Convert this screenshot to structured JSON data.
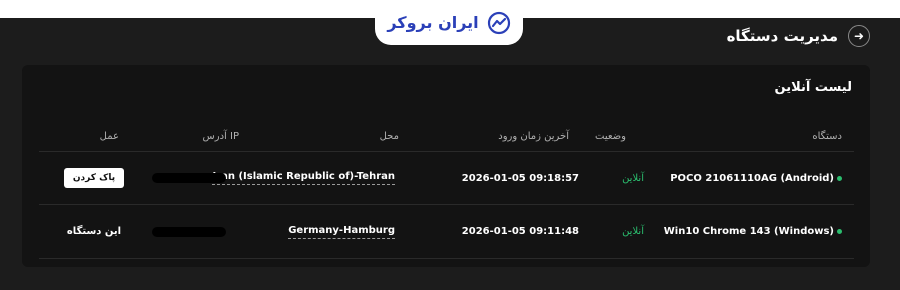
{
  "brand": {
    "logo_text": "ایران بروکر"
  },
  "header": {
    "title": "مدیریت دستگاه",
    "back_icon": "arrow-right-icon"
  },
  "card": {
    "title": "لیست آنلاین",
    "columns": {
      "device": "دستگاه",
      "status": "وضعیت",
      "last_login": "آخرین زمان ورود",
      "location": "محل",
      "ip": "آدرس IP",
      "action": "عمل"
    },
    "rows": [
      {
        "device": "POCO 21061110AG (Android)",
        "status": "آنلاین",
        "last_login": "2026-01-05 09:18:57",
        "location": "Iran (Islamic Republic of)-Tehran",
        "action": "پاک کردن"
      },
      {
        "device": "Win10 Chrome 143 (Windows)",
        "status": "آنلاین",
        "last_login": "2026-01-05 09:11:48",
        "location": "Germany-Hamburg",
        "action": "این دستگاه"
      }
    ]
  },
  "colors": {
    "online": "#2bbd6e",
    "brand": "#2b40b8",
    "background": "#1c1c1c",
    "card": "#131313"
  }
}
